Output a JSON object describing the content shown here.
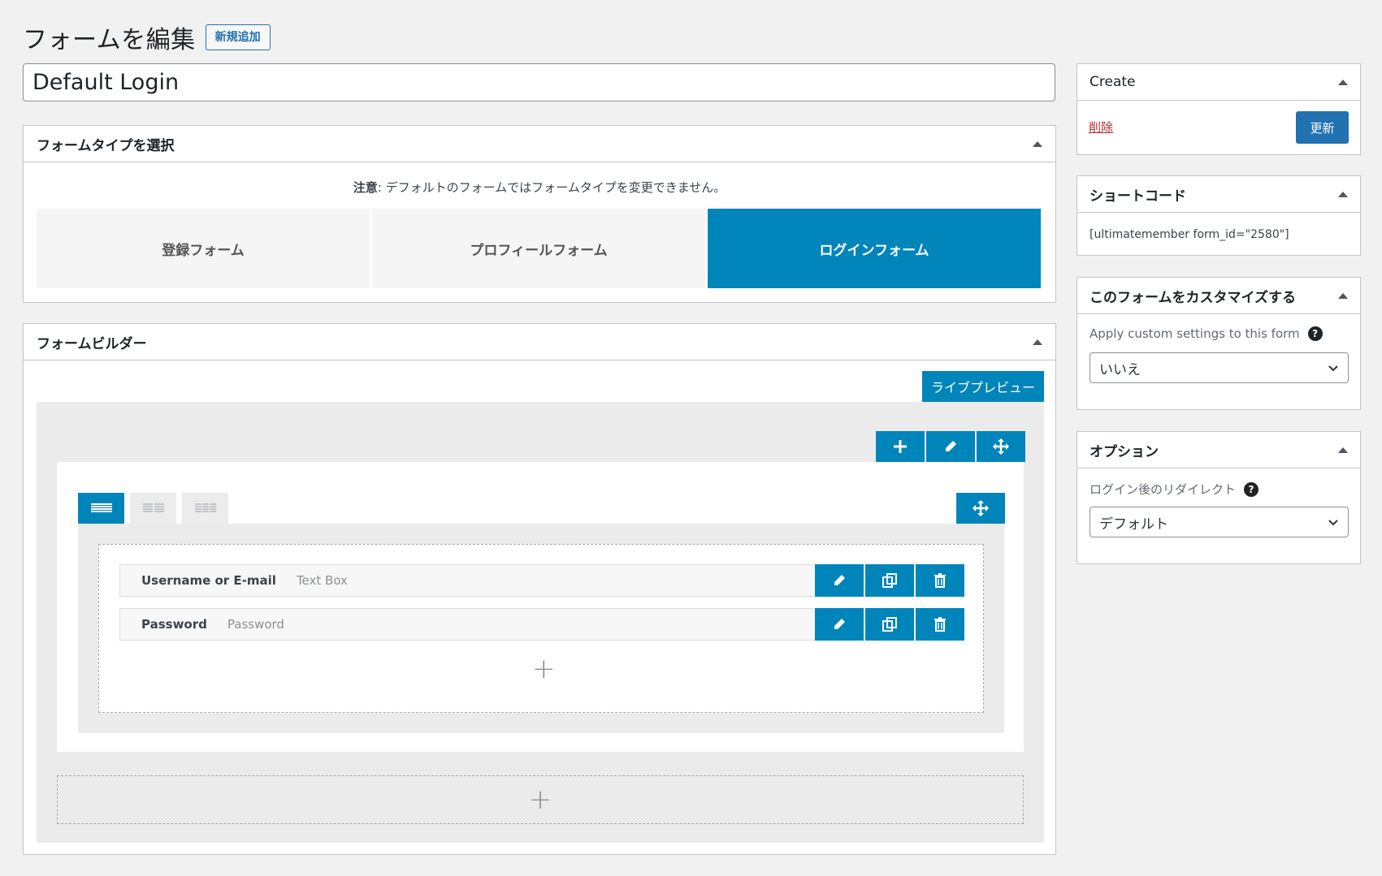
{
  "header": {
    "title": "フォームを編集",
    "add_new": "新規追加"
  },
  "form_title_value": "Default Login",
  "form_type": {
    "title": "フォームタイプを選択",
    "notice_bold": "注意",
    "notice_text": ": デフォルトのフォームではフォームタイプを変更できません。",
    "options": [
      {
        "label": "登録フォーム",
        "active": false
      },
      {
        "label": "プロフィールフォーム",
        "active": false
      },
      {
        "label": "ログインフォーム",
        "active": true
      }
    ]
  },
  "builder": {
    "title": "フォームビルダー",
    "live_preview": "ライブプレビュー",
    "fields": [
      {
        "label": "Username or E-mail",
        "type": "Text Box"
      },
      {
        "label": "Password",
        "type": "Password"
      }
    ],
    "add_symbol": "+"
  },
  "sidebar": {
    "create": {
      "title": "Create",
      "delete": "削除",
      "update": "更新"
    },
    "shortcode": {
      "title": "ショートコード",
      "code": "[ultimatemember form_id=\"2580\"]"
    },
    "customize": {
      "title": "このフォームをカスタマイズする",
      "label": "Apply custom settings to this form",
      "selected": "いいえ"
    },
    "options": {
      "title": "オプション",
      "label": "ログイン後のリダイレクト",
      "selected": "デフォルト"
    },
    "help_symbol": "?"
  },
  "colors": {
    "accent": "#0085ba",
    "wp_blue": "#2271b1",
    "delete_red": "#b32d2e"
  }
}
